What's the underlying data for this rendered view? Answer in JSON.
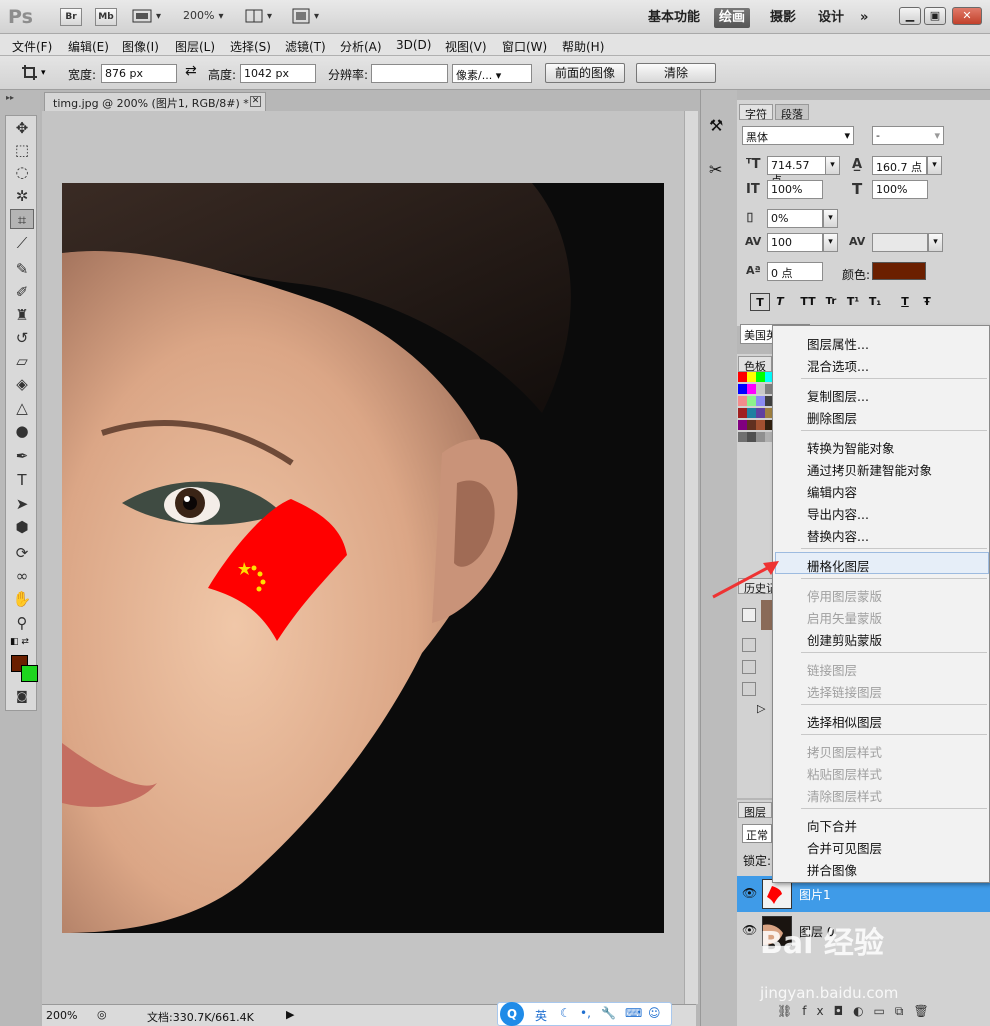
{
  "app": {
    "logo": "Ps",
    "buttons": {
      "bridge": "Br",
      "minibridge": "Mb"
    },
    "zoom_select": "200%",
    "workspaces": [
      "基本功能",
      "绘画",
      "摄影",
      "设计"
    ],
    "active_workspace": "绘画",
    "more": "»",
    "window_controls": {
      "minimize": "▁",
      "restore": "▣",
      "close": "✕"
    }
  },
  "menubar": [
    "文件(F)",
    "编辑(E)",
    "图像(I)",
    "图层(L)",
    "选择(S)",
    "滤镜(T)",
    "分析(A)",
    "3D(D)",
    "视图(V)",
    "窗口(W)",
    "帮助(H)"
  ],
  "options": {
    "width_label": "宽度:",
    "width_value": "876 px",
    "swap": "⇄",
    "height_label": "高度:",
    "height_value": "1042 px",
    "resolution_label": "分辨率:",
    "resolution_value": "",
    "unit": "像素/...",
    "front_image_button": "前面的图像",
    "clear_button": "清除"
  },
  "document": {
    "tab_title": "timg.jpg @ 200% (图片1, RGB/8#) *",
    "tab_close": "✕",
    "status_zoom": "200%",
    "status_doc": "文档:330.7K/661.4K"
  },
  "char_panel": {
    "tabs": [
      "字符",
      "段落"
    ],
    "font_family": "黑体",
    "font_style": "-",
    "font_size": "714.57 点",
    "leading": "160.7 点",
    "vertical_scale": "100%",
    "horizontal_scale": "100%",
    "tracking_ratio": "0%",
    "tracking": "100",
    "baseline_shift": "0 点",
    "color_label": "颜色:",
    "color_value": "#6b1f00",
    "style_buttons": [
      "T",
      "T",
      "TT",
      "Tr",
      "T¹",
      "T₁",
      "T",
      "Ŧ"
    ],
    "language": "美国英"
  },
  "swatch_panel": {
    "tab": "色板"
  },
  "history_panel": {
    "tab": "历史记"
  },
  "layers_panel": {
    "tab": "图层",
    "blend_mode": "正常",
    "lock_label": "锁定:",
    "layers": [
      {
        "name": "图片1",
        "selected": true
      },
      {
        "name": "图层 0",
        "selected": false
      }
    ],
    "footer_icons": [
      "link-icon",
      "fx-icon",
      "mask-icon",
      "adjustment-icon",
      "group-icon",
      "new-layer-icon",
      "trash-icon"
    ]
  },
  "context_menu": {
    "highlighted": "栅格化图层",
    "groups": [
      [
        {
          "label": "图层属性...",
          "enabled": true
        },
        {
          "label": "混合选项...",
          "enabled": true
        }
      ],
      [
        {
          "label": "复制图层...",
          "enabled": true
        },
        {
          "label": "删除图层",
          "enabled": true
        }
      ],
      [
        {
          "label": "转换为智能对象",
          "enabled": true
        },
        {
          "label": "通过拷贝新建智能对象",
          "enabled": true
        },
        {
          "label": "编辑内容",
          "enabled": true
        },
        {
          "label": "导出内容...",
          "enabled": true
        },
        {
          "label": "替换内容...",
          "enabled": true
        }
      ],
      [
        {
          "label": "栅格化图层",
          "enabled": true
        }
      ],
      [
        {
          "label": "停用图层蒙版",
          "enabled": false
        },
        {
          "label": "启用矢量蒙版",
          "enabled": false
        },
        {
          "label": "创建剪贴蒙版",
          "enabled": true
        }
      ],
      [
        {
          "label": "链接图层",
          "enabled": false
        },
        {
          "label": "选择链接图层",
          "enabled": false
        }
      ],
      [
        {
          "label": "选择相似图层",
          "enabled": true
        }
      ],
      [
        {
          "label": "拷贝图层样式",
          "enabled": false
        },
        {
          "label": "粘贴图层样式",
          "enabled": false
        },
        {
          "label": "清除图层样式",
          "enabled": false
        }
      ],
      [
        {
          "label": "向下合并",
          "enabled": true
        },
        {
          "label": "合并可见图层",
          "enabled": true
        },
        {
          "label": "拼合图像",
          "enabled": true
        }
      ]
    ]
  },
  "taskbar": {
    "ime": "英"
  },
  "watermark": {
    "brand": "Bai 经验",
    "sub": "jingyan.baidu.com"
  },
  "colors": {
    "foreground": "#6b1f00",
    "background": "#1ed51e",
    "flag_red": "#ff0000",
    "flag_star": "#ffde00"
  }
}
